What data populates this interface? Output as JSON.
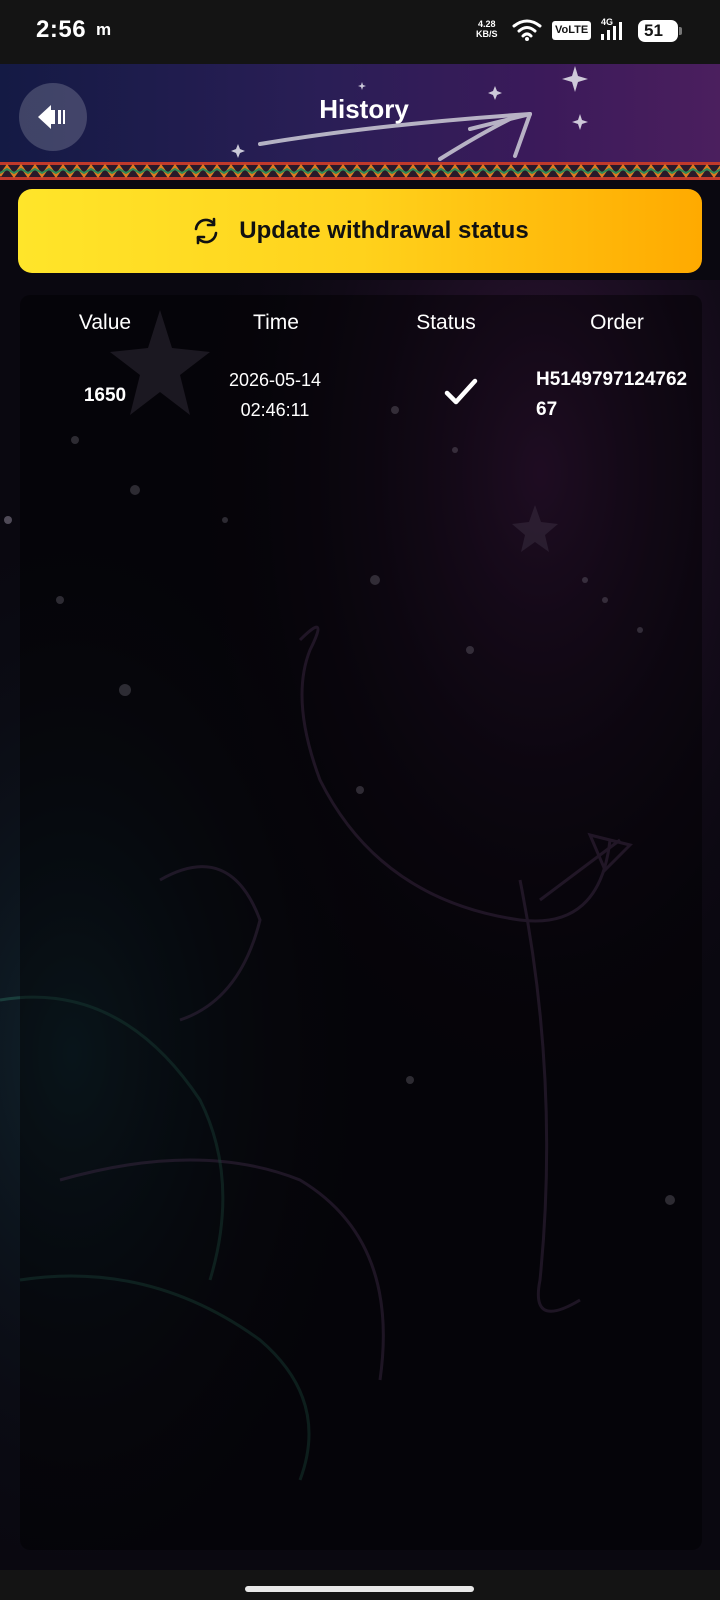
{
  "status_bar": {
    "time": "2:56",
    "notification_glyph": "m",
    "net_speed_value": "4.28",
    "net_speed_unit": "KB/S",
    "volte": "VoLTE",
    "network": "4G",
    "battery": "51"
  },
  "header": {
    "title": "History",
    "back_icon": "back-arrow-icon"
  },
  "update_button": {
    "label": "Update withdrawal status",
    "icon": "refresh-icon"
  },
  "table": {
    "columns": [
      "Value",
      "Time",
      "Status",
      "Order"
    ],
    "rows": [
      {
        "value": "1650",
        "date": "2026-05-14",
        "time": "02:46:11",
        "status_icon": "checkmark-icon",
        "order": "H514979712476267"
      }
    ]
  },
  "colors": {
    "button_gradient_start": "#ffe52a",
    "button_gradient_end": "#ffaa00",
    "header_start": "#141a44",
    "header_end": "#4b1f5e"
  }
}
